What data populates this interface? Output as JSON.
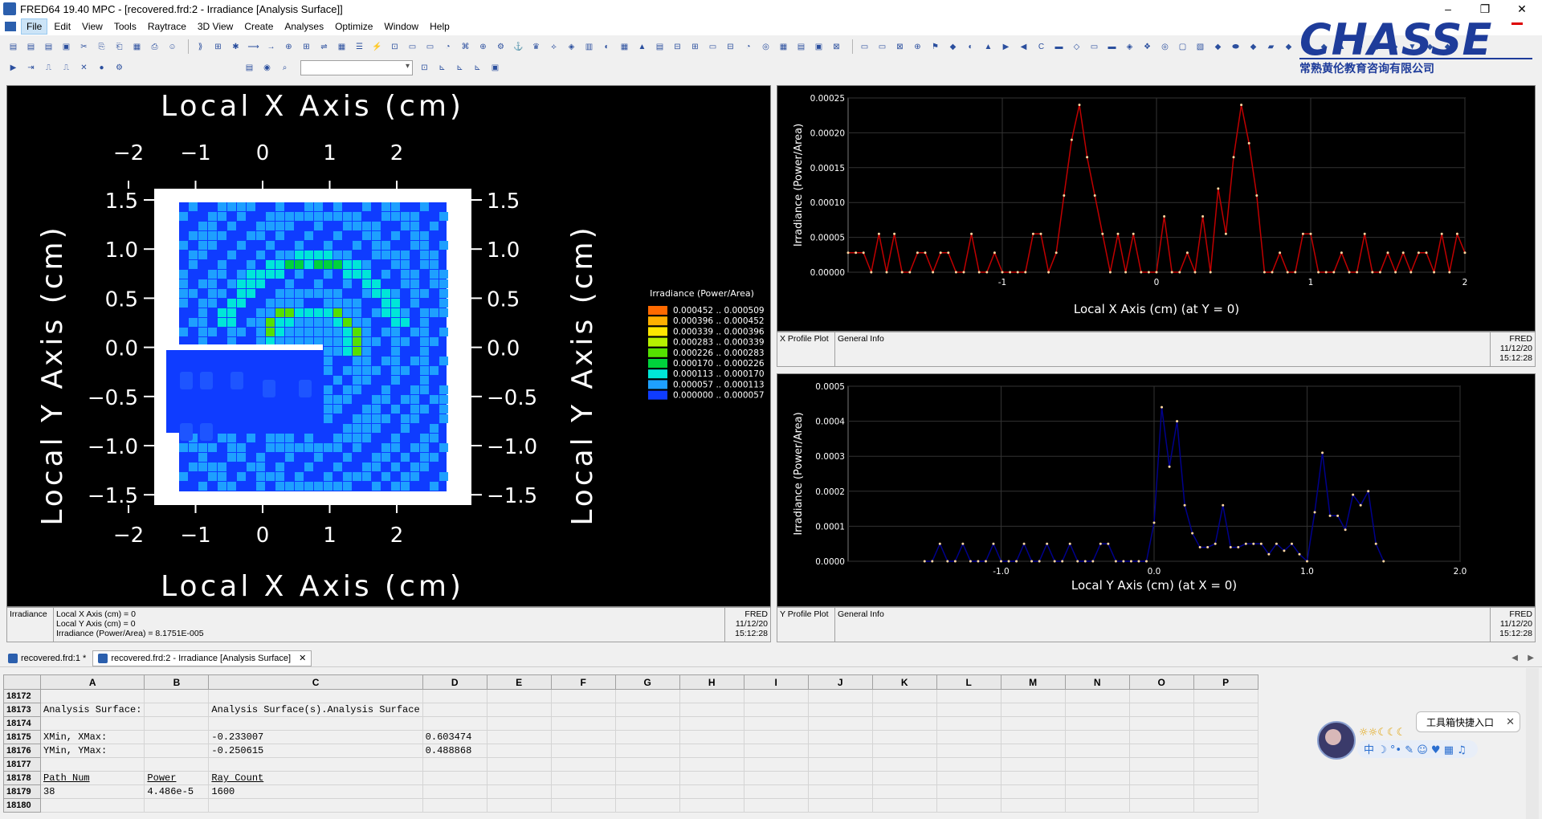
{
  "window": {
    "title": "FRED64 19.40 MPC  -  [recovered.frd:2 - Irradiance   [Analysis Surface]]"
  },
  "window_controls": {
    "minimize": "–",
    "restore": "❐",
    "close": "✕"
  },
  "menu": [
    "File",
    "Edit",
    "View",
    "Tools",
    "Raytrace",
    "3D View",
    "Create",
    "Analyses",
    "Optimize",
    "Window",
    "Help"
  ],
  "logo": {
    "brand": "CHASSE",
    "subtitle": "常熟黄伦教育咨询有限公司"
  },
  "irradiance_plot": {
    "x_axis_label": "Local X Axis (cm)",
    "y_axis_label": "Local Y Axis (cm)",
    "x_ticks": [
      "−2",
      "−1",
      "0",
      "1",
      "2"
    ],
    "y_ticks": [
      "1.5",
      "1.0",
      "0.5",
      "0.0",
      "−0.5",
      "−1.0",
      "−1.5"
    ],
    "legend_title": "Irradiance (Power/Area)",
    "legend": [
      {
        "label": "0.000452 .. 0.000509",
        "color": "#ff6a00"
      },
      {
        "label": "0.000396 .. 0.000452",
        "color": "#ffb000"
      },
      {
        "label": "0.000339 .. 0.000396",
        "color": "#ffe600"
      },
      {
        "label": "0.000283 .. 0.000339",
        "color": "#b6f000"
      },
      {
        "label": "0.000226 .. 0.000283",
        "color": "#55e000"
      },
      {
        "label": "0.000170 .. 0.000226",
        "color": "#00d23c"
      },
      {
        "label": "0.000113 .. 0.000170",
        "color": "#00e6d8"
      },
      {
        "label": "0.000057 .. 0.000113",
        "color": "#1ea0ff"
      },
      {
        "label": "0.000000 .. 0.000057",
        "color": "#0f3cff"
      }
    ],
    "info": {
      "label": "Irradiance",
      "line1": "Local X Axis (cm) = 0",
      "line2": "Local Y Axis (cm) = 0",
      "line3": "Irradiance (Power/Area) = 8.1751E-005",
      "app": "FRED",
      "date": "11/12/20",
      "time": "15:12:28"
    }
  },
  "chart_data": [
    {
      "type": "line",
      "title": "",
      "xlabel": "Local X Axis (cm) (at Y = 0)",
      "ylabel": "Irradiance (Power/Area)",
      "xlim": [
        -2,
        2
      ],
      "ylim": [
        0,
        0.00025
      ],
      "x_ticks": [
        "-1",
        "0",
        "1",
        "2"
      ],
      "y_ticks": [
        "0.00000",
        "0.00005",
        "0.00010",
        "0.00015",
        "0.00020",
        "0.00025"
      ],
      "series": [
        {
          "color": "#c00000",
          "x": [
            -2.0,
            -1.95,
            -1.9,
            -1.85,
            -1.8,
            -1.75,
            -1.7,
            -1.65,
            -1.6,
            -1.55,
            -1.5,
            -1.45,
            -1.4,
            -1.35,
            -1.3,
            -1.25,
            -1.2,
            -1.15,
            -1.1,
            -1.05,
            -1.0,
            -0.95,
            -0.9,
            -0.85,
            -0.8,
            -0.75,
            -0.7,
            -0.65,
            -0.6,
            -0.55,
            -0.5,
            -0.45,
            -0.4,
            -0.35,
            -0.3,
            -0.25,
            -0.2,
            -0.15,
            -0.1,
            -0.05,
            0.0,
            0.05,
            0.1,
            0.15,
            0.2,
            0.25,
            0.3,
            0.35,
            0.4,
            0.45,
            0.5,
            0.55,
            0.6,
            0.65,
            0.7,
            0.75,
            0.8,
            0.85,
            0.9,
            0.95,
            1.0,
            1.05,
            1.1,
            1.15,
            1.2,
            1.25,
            1.3,
            1.35,
            1.4,
            1.45,
            1.5,
            1.55,
            1.6,
            1.65,
            1.7,
            1.75,
            1.8,
            1.85,
            1.9,
            1.95,
            2.0
          ],
          "y": [
            2.8e-05,
            2.8e-05,
            2.8e-05,
            0.0,
            5.5e-05,
            0.0,
            5.5e-05,
            0.0,
            0.0,
            2.8e-05,
            2.8e-05,
            0.0,
            2.8e-05,
            2.8e-05,
            0.0,
            0.0,
            5.5e-05,
            0.0,
            0.0,
            2.8e-05,
            0.0,
            0.0,
            0.0,
            0.0,
            5.5e-05,
            5.5e-05,
            0.0,
            2.8e-05,
            0.00011,
            0.00019,
            0.00024,
            0.000165,
            0.00011,
            5.5e-05,
            0.0,
            5.5e-05,
            0.0,
            5.5e-05,
            0.0,
            0.0,
            0.0,
            8e-05,
            0.0,
            0.0,
            2.8e-05,
            0.0,
            8e-05,
            0.0,
            0.00012,
            5.5e-05,
            0.000165,
            0.00024,
            0.000185,
            0.00011,
            0.0,
            0.0,
            2.8e-05,
            0.0,
            0.0,
            5.5e-05,
            5.5e-05,
            0.0,
            0.0,
            0.0,
            2.8e-05,
            0.0,
            0.0,
            5.5e-05,
            0.0,
            0.0,
            2.8e-05,
            0.0,
            2.8e-05,
            0.0,
            2.8e-05,
            2.8e-05,
            0.0,
            5.5e-05,
            0.0,
            5.5e-05,
            2.8e-05
          ]
        }
      ],
      "info": {
        "label": "X Profile Plot",
        "general": "General Info",
        "app": "FRED",
        "date": "11/12/20",
        "time": "15:12:28"
      }
    },
    {
      "type": "line",
      "title": "",
      "xlabel": "Local Y Axis (cm) (at X = 0)",
      "ylabel": "Irradiance (Power/Area)",
      "xlim": [
        -2,
        2
      ],
      "ylim": [
        0,
        0.0005
      ],
      "x_ticks": [
        "-1.0",
        "0.0",
        "1.0",
        "2.0"
      ],
      "y_ticks": [
        "0.0000",
        "0.0001",
        "0.0002",
        "0.0003",
        "0.0004",
        "0.0005"
      ],
      "series": [
        {
          "color": "#00008c",
          "x": [
            -1.5,
            -1.45,
            -1.4,
            -1.35,
            -1.3,
            -1.25,
            -1.2,
            -1.15,
            -1.1,
            -1.05,
            -1.0,
            -0.95,
            -0.9,
            -0.85,
            -0.8,
            -0.75,
            -0.7,
            -0.65,
            -0.6,
            -0.55,
            -0.5,
            -0.45,
            -0.4,
            -0.35,
            -0.3,
            -0.25,
            -0.2,
            -0.15,
            -0.1,
            -0.05,
            0.0,
            0.05,
            0.1,
            0.15,
            0.2,
            0.25,
            0.3,
            0.35,
            0.4,
            0.45,
            0.5,
            0.55,
            0.6,
            0.65,
            0.7,
            0.75,
            0.8,
            0.85,
            0.9,
            0.95,
            1.0,
            1.05,
            1.1,
            1.15,
            1.2,
            1.25,
            1.3,
            1.35,
            1.4,
            1.45,
            1.5
          ],
          "y": [
            0.0,
            0.0,
            5e-05,
            0.0,
            0.0,
            5e-05,
            0.0,
            0.0,
            0.0,
            5e-05,
            0.0,
            0.0,
            0.0,
            5e-05,
            0.0,
            0.0,
            5e-05,
            0.0,
            0.0,
            5e-05,
            0.0,
            0.0,
            0.0,
            5e-05,
            5e-05,
            0.0,
            0.0,
            0.0,
            0.0,
            0.0,
            0.00011,
            0.00044,
            0.00027,
            0.0004,
            0.00016,
            8e-05,
            4e-05,
            4e-05,
            5e-05,
            0.00016,
            4e-05,
            4e-05,
            5e-05,
            5e-05,
            5e-05,
            2e-05,
            5e-05,
            3e-05,
            5e-05,
            2e-05,
            0.0,
            0.00014,
            0.00031,
            0.00013,
            0.00013,
            9e-05,
            0.00019,
            0.00016,
            0.0002,
            5e-05,
            0.0
          ]
        }
      ],
      "info": {
        "label": "Y Profile Plot",
        "general": "General Info",
        "app": "FRED",
        "date": "11/12/20",
        "time": "15:12:28"
      }
    }
  ],
  "tabs": [
    {
      "label": "recovered.frd:1 *"
    },
    {
      "label": "recovered.frd:2 - Irradiance   [Analysis Surface]"
    }
  ],
  "sheet": {
    "columns": [
      "A",
      "B",
      "C",
      "D",
      "E",
      "F",
      "G",
      "H",
      "I",
      "J",
      "K",
      "L",
      "M",
      "N",
      "O",
      "P"
    ],
    "rows": [
      {
        "n": "18172",
        "cells": [
          "",
          "",
          "",
          "",
          "",
          "",
          ""
        ]
      },
      {
        "n": "18173",
        "cells": [
          "Analysis Surface:",
          "",
          "Analysis Surface(s).Analysis Surface",
          "",
          "",
          "",
          ""
        ]
      },
      {
        "n": "18174",
        "cells": [
          "",
          "",
          "",
          "",
          "",
          "",
          ""
        ]
      },
      {
        "n": "18175",
        "cells": [
          "XMin, XMax:",
          "",
          "-0.233007",
          "0.603474",
          "",
          "",
          ""
        ]
      },
      {
        "n": "18176",
        "cells": [
          "YMin, YMax:",
          "",
          "-0.250615",
          "0.488868",
          "",
          "",
          ""
        ]
      },
      {
        "n": "18177",
        "cells": [
          "",
          "",
          "",
          "",
          "",
          "",
          ""
        ]
      },
      {
        "n": "18178",
        "cells": [
          "Path Num",
          "Power",
          "Ray Count",
          "",
          "",
          "",
          ""
        ]
      },
      {
        "n": "18179",
        "cells": [
          "38",
          "4.486e-5",
          "1600",
          "",
          "",
          "",
          ""
        ]
      },
      {
        "n": "18180",
        "cells": [
          "",
          "",
          "",
          "",
          "",
          "",
          ""
        ]
      }
    ]
  },
  "tooltip": {
    "label": "工具箱快捷入口"
  },
  "widget": {
    "chars": "中 ☽ °• ✎ ☺ ♥ ▦ ♫"
  }
}
